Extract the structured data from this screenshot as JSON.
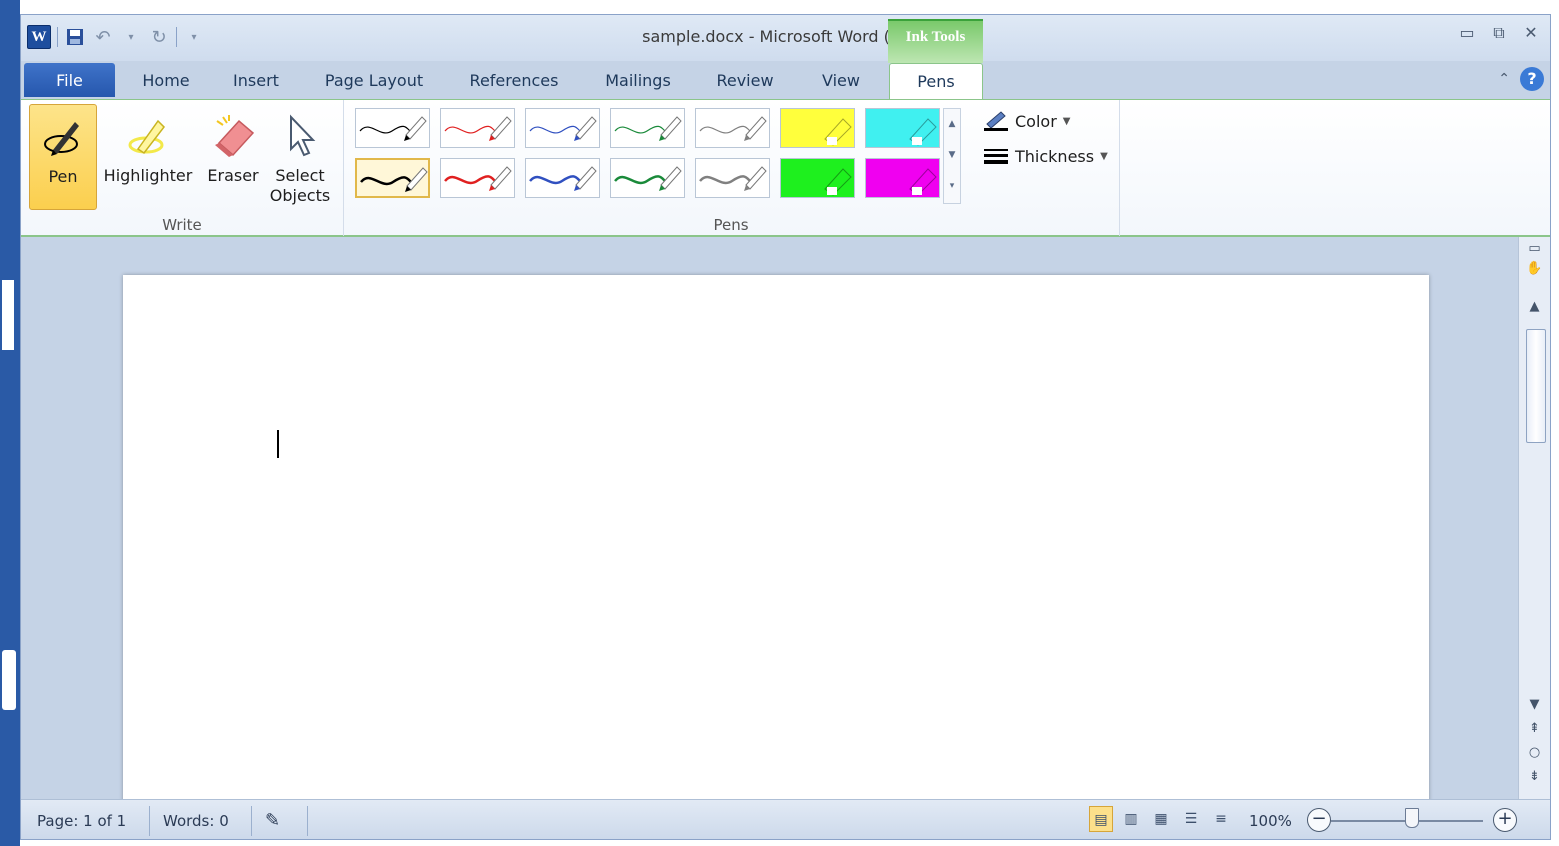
{
  "window": {
    "title": "sample.docx - Microsoft Word (Trial)",
    "context_tab_group": "Ink Tools"
  },
  "qat": {
    "icons": [
      "word-logo-icon",
      "save-icon",
      "undo-icon",
      "redo-icon",
      "customize-icon"
    ],
    "word_logo_letter": "W"
  },
  "tabs": [
    {
      "label": "File"
    },
    {
      "label": "Home"
    },
    {
      "label": "Insert"
    },
    {
      "label": "Page Layout"
    },
    {
      "label": "References"
    },
    {
      "label": "Mailings"
    },
    {
      "label": "Review"
    },
    {
      "label": "View"
    },
    {
      "label": "Pens"
    }
  ],
  "ribbon": {
    "write_group": {
      "label": "Write",
      "buttons": [
        {
          "label": "Pen",
          "selected": true
        },
        {
          "label": "Highlighter"
        },
        {
          "label": "Eraser"
        },
        {
          "label": "Select Objects",
          "line1": "Select",
          "line2": "Objects"
        }
      ]
    },
    "pens_group": {
      "label": "Pens",
      "pen_row1_colors": [
        "#000000",
        "#e02020",
        "#3050c0",
        "#1a8a3a",
        "#808080"
      ],
      "pen_row2_colors": [
        "#000000",
        "#e02020",
        "#3050c0",
        "#1a8a3a",
        "#808080"
      ],
      "highlighters_row1": [
        "#ffff3c",
        "#40f0f0"
      ],
      "highlighters_row2": [
        "#1ef01e",
        "#f000f0"
      ],
      "color_label": "Color",
      "thickness_label": "Thickness"
    }
  },
  "status": {
    "page": "Page: 1 of 1",
    "words": "Words: 0",
    "zoom": "100%",
    "zoom_out": "−",
    "zoom_in": "+",
    "zoom_level_percent": 100
  },
  "colors": {
    "accent_green": "#8bc58a",
    "file_tab": "#2657ad",
    "selected_button": "#fbcf4e"
  }
}
